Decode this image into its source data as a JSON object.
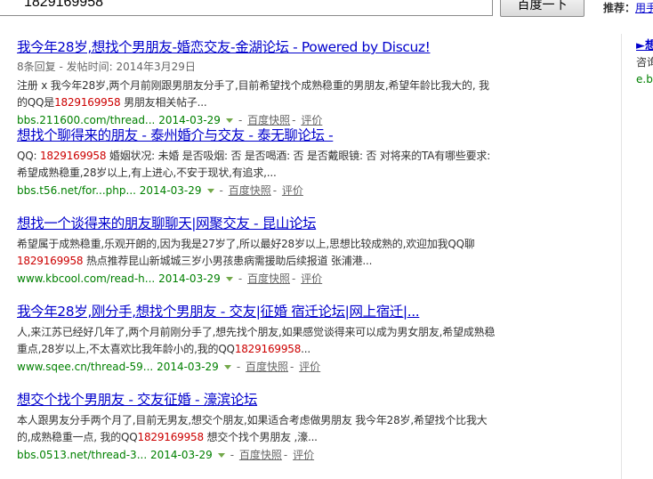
{
  "search": {
    "query": "1829169958",
    "button_label": "百度一下"
  },
  "recommend": {
    "label": "推荐：",
    "link": "用手"
  },
  "side_ad": {
    "title": "►想",
    "desc": "咨询",
    "url": "e.b"
  },
  "results": [
    {
      "title": "我今年28岁,想找个男朋友-婚恋交友-金湖论坛 - Powered by Discuz!",
      "meta": "8条回复 - 发帖时间: 2014年3月29日",
      "abstract_parts": [
        {
          "text": "注册 x 我今年28岁,两个月前刚跟男朋友分手了,目前希望找个成熟稳重的男朋友,希望年龄比我大的, 我的QQ是",
          "hl": false
        },
        {
          "text": "1829169958",
          "hl": true
        },
        {
          "text": " 男朋友相关帖子...",
          "hl": false
        }
      ],
      "url": "bbs.211600.com/thread...",
      "date": "2014-03-29",
      "snapshot": "百度快照",
      "review": "评价"
    },
    {
      "title": "想找个聊得来的朋友 - 泰州婚介与交友 - 泰无聊论坛 -",
      "meta": "",
      "abstract_parts": [
        {
          "text": "QQ: ",
          "hl": false
        },
        {
          "text": "1829169958",
          "hl": true
        },
        {
          "text": " 婚姻状况: 未婚 是否吸烟: 否 是否喝酒: 否 是否戴眼镜: 否 对将来的TA有哪些要求: 希望成熟稳重,28岁以上,有上进心,不安于现状,有追求,...",
          "hl": false
        }
      ],
      "url": "bbs.t56.net/for...php...",
      "date": "2014-03-29",
      "snapshot": "百度快照",
      "review": "评价"
    },
    {
      "title": "想找一个谈得来的朋友聊聊天|网聚交友 - 昆山论坛",
      "meta": "",
      "abstract_parts": [
        {
          "text": "希望属于成熟稳重,乐观开朗的,因为我是27岁了,所以最好28岁以上,思想比较成熟的,欢迎加我QQ聊",
          "hl": false
        },
        {
          "text": "1829169958",
          "hl": true
        },
        {
          "text": " 热点推荐昆山新城城三岁小男孩患病需援助后续报道 张浦港...",
          "hl": false
        }
      ],
      "url": "www.kbcool.com/read-h...",
      "date": "2014-03-29",
      "snapshot": "百度快照",
      "review": "评价"
    },
    {
      "title": "我今年28岁,刚分手,想找个男朋友 - 交友|征婚 宿迁论坛|网上宿迁|...",
      "meta": "",
      "abstract_parts": [
        {
          "text": "人,来江苏已经好几年了,两个月前刚分手了,想先找个朋友,如果感觉谈得来可以成为男女朋友,希望成熟稳重点,28岁以上,不太喜欢比我年龄小的,我的QQ",
          "hl": false
        },
        {
          "text": "1829169958",
          "hl": true
        },
        {
          "text": "...",
          "hl": false
        }
      ],
      "url": "www.sqee.cn/thread-59...",
      "date": "2014-03-29",
      "snapshot": "百度快照",
      "review": "评价"
    },
    {
      "title": "想交个找个男朋友 - 交友征婚 - 濠滨论坛",
      "meta": "",
      "abstract_parts": [
        {
          "text": "本人跟男友分手两个月了,目前无男友,想交个朋友,如果适合考虑做男朋友 我今年28岁,希望找个比我大的,成熟稳重一点, 我的QQ",
          "hl": false
        },
        {
          "text": "1829169958",
          "hl": true
        },
        {
          "text": " 想交个找个男朋友 ,濠...",
          "hl": false
        }
      ],
      "url": "bbs.0513.net/thread-3...",
      "date": "2014-03-29",
      "snapshot": "百度快照",
      "review": "评价"
    }
  ]
}
